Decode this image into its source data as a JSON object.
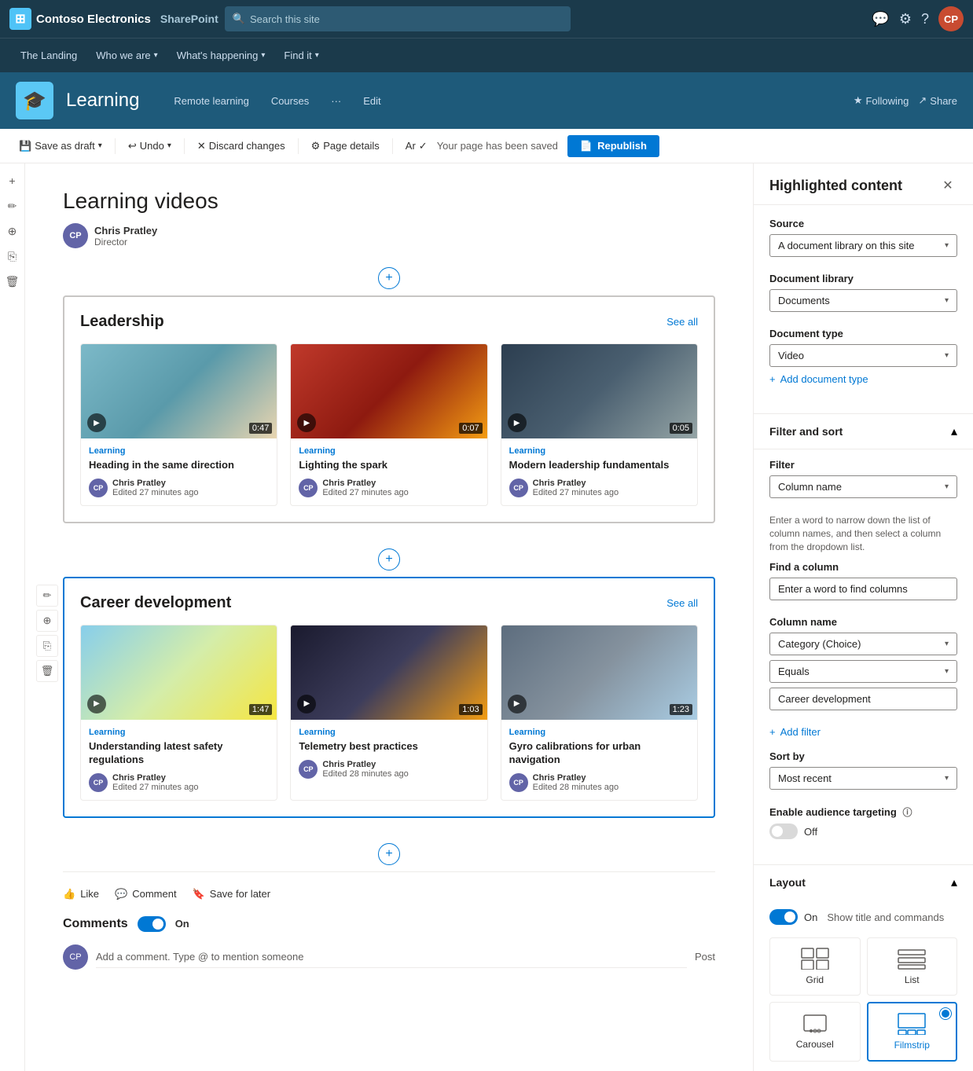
{
  "app": {
    "logo_text": "Contoso Electronics",
    "product": "SharePoint",
    "search_placeholder": "Search this site"
  },
  "site_nav": {
    "items": [
      {
        "label": "The Landing",
        "has_dropdown": false
      },
      {
        "label": "Who we are",
        "has_dropdown": true
      },
      {
        "label": "What's happening",
        "has_dropdown": true
      },
      {
        "label": "Find it",
        "has_dropdown": true
      }
    ]
  },
  "site_header": {
    "icon": "🎓",
    "title": "Learning",
    "nav_items": [
      "Remote learning",
      "Courses"
    ],
    "more_label": "···",
    "edit_label": "Edit",
    "following_label": "Following",
    "share_label": "Share"
  },
  "toolbar": {
    "save_draft_label": "Save as draft",
    "undo_label": "Undo",
    "discard_label": "Discard changes",
    "page_details_label": "Page details",
    "ar_label": "Ar",
    "saved_label": "Your page has been saved",
    "republish_label": "Republish"
  },
  "page": {
    "title": "Learning videos",
    "author": {
      "name": "Chris Pratley",
      "role": "Director",
      "initials": "CP"
    }
  },
  "sections": [
    {
      "id": "leadership",
      "title": "Leadership",
      "see_all": "See all",
      "videos": [
        {
          "category": "Learning",
          "title": "Heading in the same direction",
          "author": "Chris Pratley",
          "edited": "Edited 27 minutes ago",
          "duration": "0:47",
          "thumb_class": "thumb-1",
          "initials": "CP"
        },
        {
          "category": "Learning",
          "title": "Lighting the spark",
          "author": "Chris Pratley",
          "edited": "Edited 27 minutes ago",
          "duration": "0:07",
          "thumb_class": "thumb-2",
          "initials": "CP"
        },
        {
          "category": "Learning",
          "title": "Modern leadership fundamentals",
          "author": "Chris Pratley",
          "edited": "Edited 27 minutes ago",
          "duration": "0:05",
          "thumb_class": "thumb-3",
          "initials": "CP"
        }
      ]
    },
    {
      "id": "career",
      "title": "Career development",
      "see_all": "See all",
      "videos": [
        {
          "category": "Learning",
          "title": "Understanding latest safety regulations",
          "author": "Chris Pratley",
          "edited": "Edited 27 minutes ago",
          "duration": "1:47",
          "thumb_class": "thumb-4",
          "initials": "CP"
        },
        {
          "category": "Learning",
          "title": "Telemetry best practices",
          "author": "Chris Pratley",
          "edited": "Edited 28 minutes ago",
          "duration": "1:03",
          "thumb_class": "thumb-5",
          "initials": "CP"
        },
        {
          "category": "Learning",
          "title": "Gyro calibrations for urban navigation",
          "author": "Chris Pratley",
          "edited": "Edited 28 minutes ago",
          "duration": "1:23",
          "thumb_class": "thumb-6",
          "initials": "CP"
        }
      ]
    }
  ],
  "page_actions": {
    "like_label": "Like",
    "comment_label": "Comment",
    "save_label": "Save for later"
  },
  "comments": {
    "header": "Comments",
    "toggle_state": "On",
    "placeholder": "Add a comment. Type @ to mention someone",
    "post_label": "Post",
    "author_initials": "CP"
  },
  "right_panel": {
    "title": "Highlighted content",
    "source_label": "Source",
    "source_value": "A document library on this site",
    "doc_library_label": "Document library",
    "doc_library_value": "Documents",
    "doc_type_label": "Document type",
    "doc_type_value": "Video",
    "add_doc_type_label": "Add document type",
    "filter_sort_title": "Filter and sort",
    "filter_label": "Filter",
    "filter_value": "Column name",
    "filter_help": "Enter a word to narrow down the list of column names, and then select a column from the dropdown list.",
    "find_column_label": "Find a column",
    "find_column_placeholder": "Enter a word to find columns",
    "column_name_label": "Column name",
    "column_name_value": "Category (Choice)",
    "equals_label": "Equals",
    "equals_value": "Equals",
    "filter_text_value": "Career development",
    "add_filter_label": "Add filter",
    "sort_by_label": "Sort by",
    "sort_by_value": "Most recent",
    "audience_label": "Enable audience targeting",
    "audience_toggle": "Off",
    "layout_title": "Layout",
    "show_title_label": "Show title and commands",
    "show_title_toggle": "On",
    "layout_options": [
      {
        "id": "grid",
        "label": "Grid",
        "selected": false,
        "icon": "⊞"
      },
      {
        "id": "list",
        "label": "List",
        "selected": false,
        "icon": "≡"
      },
      {
        "id": "carousel",
        "label": "Carousel",
        "selected": false,
        "icon": "◫"
      },
      {
        "id": "filmstrip",
        "label": "Filmstrip",
        "selected": true,
        "icon": "⊟"
      }
    ]
  }
}
